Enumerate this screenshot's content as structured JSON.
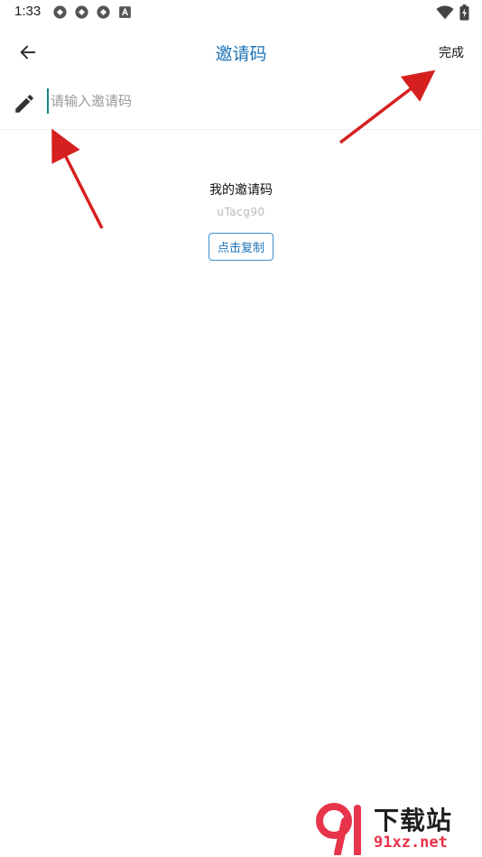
{
  "status_bar": {
    "time": "1:33",
    "left_icons": [
      "sync-icon",
      "sync-icon",
      "sync-icon",
      "a-badge-icon"
    ],
    "right_icons": [
      "wifi-icon",
      "battery-charging-icon"
    ]
  },
  "app_bar": {
    "title": "邀请码",
    "done_label": "完成",
    "title_color": "#1e74b8"
  },
  "invite_input": {
    "placeholder": "请输入邀请码",
    "value": ""
  },
  "my_code": {
    "label": "我的邀请码",
    "code": "uTacg90",
    "copy_label": "点击复制"
  },
  "watermark": {
    "main_text": "下载站",
    "sub_text": "91xz.net",
    "accent_color": "#e8344a"
  },
  "colors": {
    "accent": "#1e74b8",
    "annotation_arrow": "#d62020"
  }
}
